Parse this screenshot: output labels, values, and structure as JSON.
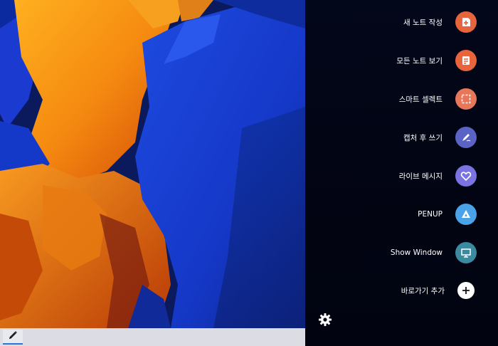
{
  "air_command": {
    "items": [
      {
        "label": "새 노트 작성",
        "icon": "new-note-icon",
        "color": "#e8643c"
      },
      {
        "label": "모든 노트 보기",
        "icon": "view-notes-icon",
        "color": "#e8643c"
      },
      {
        "label": "스마트 셀렉트",
        "icon": "smart-select-icon",
        "color": "#e8765a"
      },
      {
        "label": "캡처 후 쓰기",
        "icon": "screen-write-icon",
        "color": "#5b63c4"
      },
      {
        "label": "라이브 메시지",
        "icon": "live-message-icon",
        "color": "#7b73e0"
      },
      {
        "label": "PENUP",
        "icon": "penup-icon",
        "color": "#4aa3e8"
      },
      {
        "label": "Show Window",
        "icon": "show-window-icon",
        "color": "#3a8aa0"
      },
      {
        "label": "바로가기 추가",
        "icon": "add-shortcut-icon",
        "color": "#ffffff"
      }
    ]
  },
  "settings": {
    "icon": "settings-icon"
  },
  "taskbar": {
    "pen_icon": "pen-icon"
  }
}
